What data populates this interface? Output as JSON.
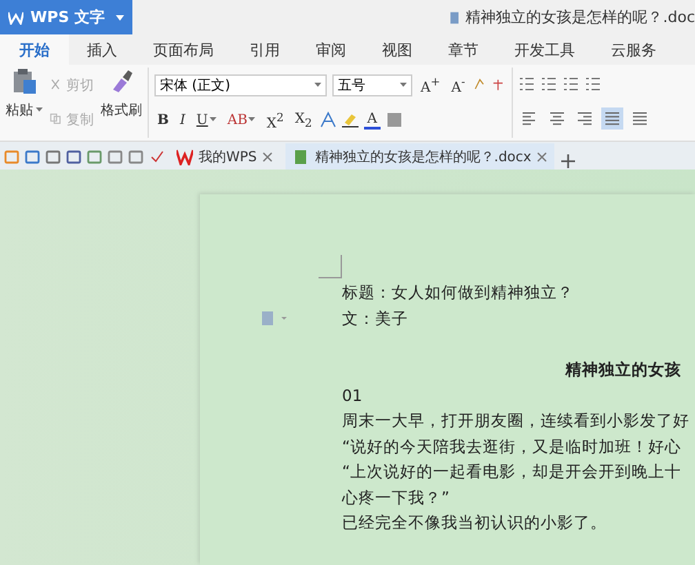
{
  "app_button": {
    "label": "WPS 文字"
  },
  "document_title": "精神独立的女孩是怎样的呢？.doc",
  "menu_tabs": [
    {
      "label": "开始",
      "selected": true
    },
    {
      "label": "插入",
      "selected": false
    },
    {
      "label": "页面布局",
      "selected": false
    },
    {
      "label": "引用",
      "selected": false
    },
    {
      "label": "审阅",
      "selected": false
    },
    {
      "label": "视图",
      "selected": false
    },
    {
      "label": "章节",
      "selected": false
    },
    {
      "label": "开发工具",
      "selected": false
    },
    {
      "label": "云服务",
      "selected": false
    }
  ],
  "clipboard": {
    "paste": "粘贴",
    "cut": {
      "label": "剪切",
      "disabled": true
    },
    "copy": {
      "label": "复制",
      "disabled": true
    },
    "format_painter": "格式刷"
  },
  "font": {
    "name": "宋体 (正文)",
    "size": "五号"
  },
  "format_buttons": [
    {
      "label": "B",
      "dropdown": false
    },
    {
      "label": "I",
      "dropdown": false
    },
    {
      "label": "U",
      "dropdown": true
    },
    {
      "label": "AB",
      "dropdown": true
    },
    {
      "label": "X$^{2}$",
      "dropdown": false
    },
    {
      "label": "X$_{2}$",
      "dropdown": false
    }
  ],
  "size_buttons": [
    {
      "label": "A$^{+}$"
    },
    {
      "label": "A$^{-}$"
    }
  ],
  "color_buttons": [
    {
      "label": "A",
      "dropdown": false
    }
  ],
  "alignment": [
    {
      "kind": "left",
      "selected": false
    },
    {
      "kind": "center",
      "selected": false
    },
    {
      "kind": "right",
      "selected": false
    },
    {
      "kind": "justify",
      "selected": true
    },
    {
      "kind": "distributed",
      "selected": false
    }
  ],
  "doc_tabs": [
    {
      "label": "我的WPS",
      "kind": "home",
      "selected": false
    },
    {
      "label": "精神独立的女孩是怎样的呢？.docx",
      "kind": "doc",
      "selected": true
    }
  ],
  "document": {
    "header_lines": [
      "标题：女人如何做到精神独立？",
      "文：美子"
    ],
    "heading": "精神独立的女孩",
    "paragraphs": [
      "01",
      "周末一大早，打开朋友圈，连续看到小影发了好",
      "“说好的今天陪我去逛街，又是临时加班！好心",
      "“上次说好的一起看电影，却是开会开到晚上十",
      "心疼一下我？”",
      "已经完全不像我当初认识的小影了。"
    ]
  }
}
